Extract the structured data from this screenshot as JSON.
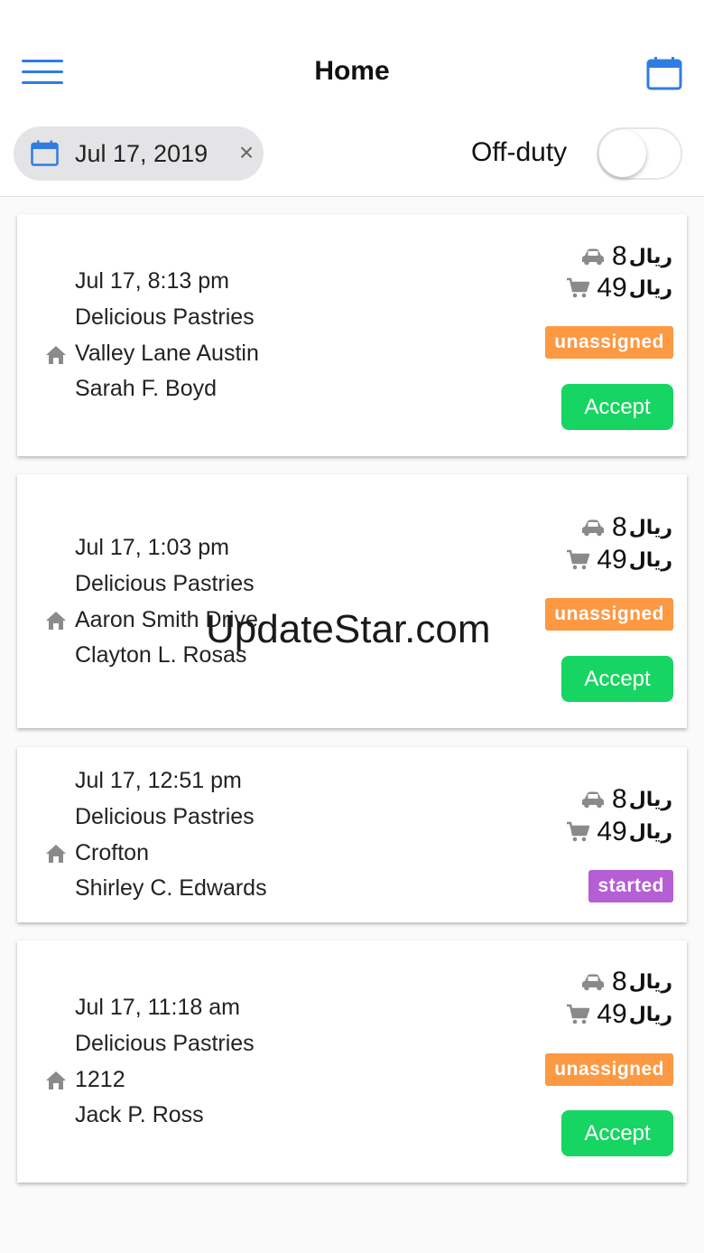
{
  "header": {
    "title": "Home"
  },
  "filter": {
    "date": "Jul 17, 2019",
    "clear_symbol": "×",
    "offduty_label": "Off-duty",
    "offduty_on": false
  },
  "currency": "ريال",
  "orders": [
    {
      "time": "Jul 17, 8:13 pm",
      "store": "Delicious Pastries",
      "address": "Valley Lane Austin",
      "customer": "Sarah F. Boyd",
      "delivery_fee": "8",
      "order_total": "49",
      "status": "unassigned",
      "action": "Accept"
    },
    {
      "time": "Jul 17, 1:03 pm",
      "store": "Delicious Pastries",
      "address": "Aaron Smith Drive",
      "customer": "Clayton L. Rosas",
      "delivery_fee": "8",
      "order_total": "49",
      "status": "unassigned",
      "action": "Accept"
    },
    {
      "time": "Jul 17, 12:51 pm",
      "store": "Delicious Pastries",
      "address": "Crofton",
      "customer": "Shirley C. Edwards",
      "delivery_fee": "8",
      "order_total": "49",
      "status": "started"
    },
    {
      "time": "Jul 17, 11:18 am",
      "store": "Delicious Pastries",
      "address": "1212",
      "customer": "Jack P. Ross",
      "delivery_fee": "8",
      "order_total": "49",
      "status": "unassigned",
      "action": "Accept"
    }
  ],
  "watermark": "UpdateStar.com",
  "colors": {
    "accent": "#2f7de1",
    "accept": "#17d562",
    "unassigned": "#fd9843",
    "started": "#b65ed4"
  },
  "icons": {
    "menu": "hamburger-icon",
    "calendar": "calendar-icon",
    "car": "car-icon",
    "cart": "cart-icon",
    "home": "home-icon"
  }
}
